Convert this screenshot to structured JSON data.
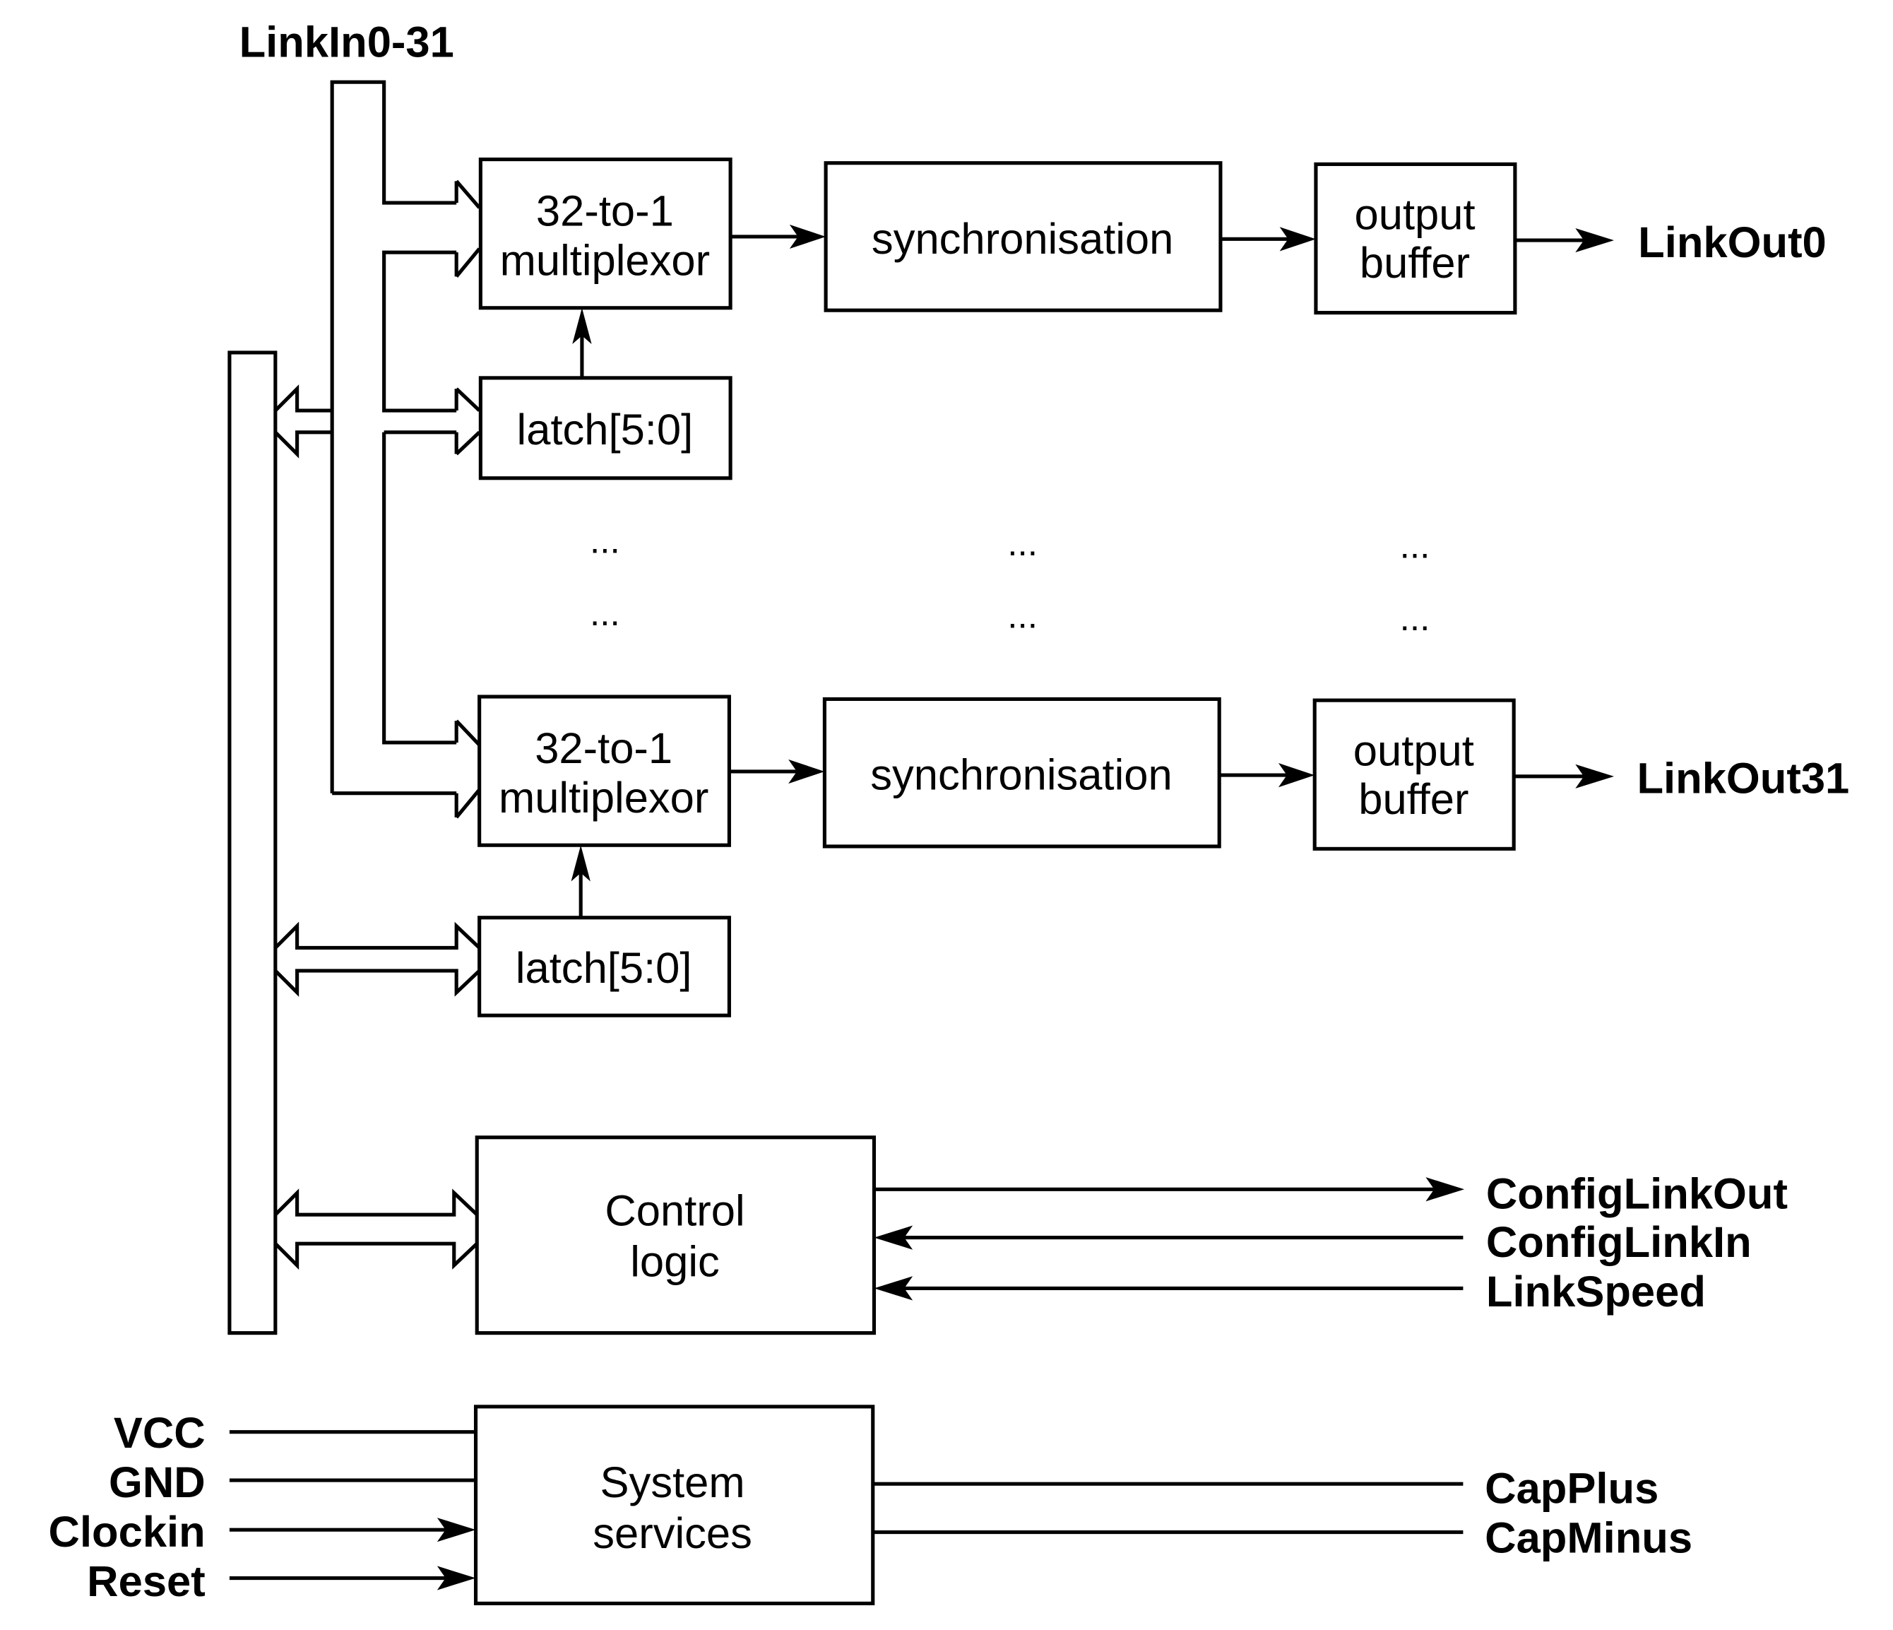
{
  "signals": {
    "link_in": "LinkIn0-31",
    "link_out_0": "LinkOut0",
    "link_out_31": "LinkOut31",
    "config_link_out": "ConfigLinkOut",
    "config_link_in": "ConfigLinkIn",
    "link_speed": "LinkSpeed",
    "vcc": "VCC",
    "gnd": "GND",
    "clockin": "Clockin",
    "reset": "Reset",
    "cap_plus": "CapPlus",
    "cap_minus": "CapMinus"
  },
  "channel_0": {
    "mux_line1": "32-to-1",
    "mux_line2": "multiplexor",
    "latch": "latch[5:0]",
    "sync": "synchronisation",
    "buffer_line1": "output",
    "buffer_line2": "buffer"
  },
  "channel_31": {
    "mux_line1": "32-to-1",
    "mux_line2": "multiplexor",
    "latch": "latch[5:0]",
    "sync": "synchronisation",
    "buffer_line1": "output",
    "buffer_line2": "buffer"
  },
  "ellipsis": "...",
  "control": {
    "line1": "Control",
    "line2": "logic"
  },
  "system": {
    "line1": "System",
    "line2": "services"
  }
}
